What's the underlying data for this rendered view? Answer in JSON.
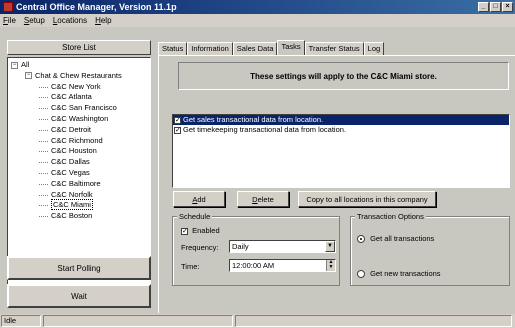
{
  "window": {
    "title": "Central Office Manager, Version 11.1p"
  },
  "menu": [
    "File",
    "Setup",
    "Locations",
    "Help"
  ],
  "store_list": {
    "header": "Store List",
    "root": "All",
    "group": "Chat & Chew Restaurants",
    "stores": [
      "C&C New York",
      "C&C Atlanta",
      "C&C San Francisco",
      "C&C Washington",
      "C&C Detroit",
      "C&C Richmond",
      "C&C Houston",
      "C&C Dallas",
      "C&C Vegas",
      "C&C Baltimore",
      "C&C Norfolk",
      "C&C Miami",
      "C&C Boston"
    ],
    "selected": "C&C Miami"
  },
  "buttons": {
    "start_polling": "Start Polling",
    "wait": "Wait",
    "add": "Add",
    "delete": "Delete",
    "copy_all": "Copy to all locations in this company"
  },
  "tabs": [
    "Status",
    "Information",
    "Sales Data",
    "Tasks",
    "Transfer Status",
    "Log"
  ],
  "active_tab": "Tasks",
  "banner": "These settings will apply to the C&C Miami store.",
  "tasks": [
    {
      "label": "Get sales transactional data from location.",
      "checked": true,
      "selected": true
    },
    {
      "label": "Get timekeeping transactional data from location.",
      "checked": true,
      "selected": false
    }
  ],
  "schedule": {
    "title": "Schedule",
    "enabled_label": "Enabled",
    "frequency_label": "Frequency:",
    "frequency_value": "Daily",
    "time_label": "Time:",
    "time_value": "12:00:00 AM"
  },
  "transaction_options": {
    "title": "Transaction Options",
    "all_label": "Get all transactions",
    "new_label": "Get new transactions"
  },
  "status": {
    "text": "Idle"
  }
}
